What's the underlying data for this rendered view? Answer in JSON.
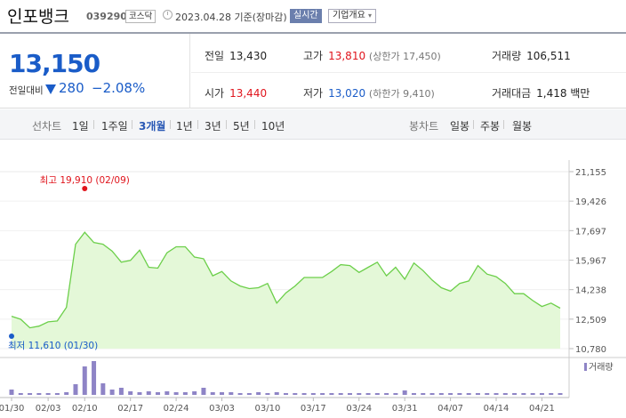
{
  "header": {
    "name": "인포뱅크",
    "code": "039290",
    "market": "코스닥",
    "date": "2023.04.28",
    "basis": "기준(장마감)",
    "live_label": "실시간",
    "corp_label": "기업개요"
  },
  "summary": {
    "price": "13,150",
    "change_label": "전일대비",
    "change_value": "280",
    "change_rate": "−2.08%",
    "prev_close": {
      "label": "전일",
      "value": "13,430"
    },
    "high": {
      "label": "고가",
      "value": "13,810",
      "sub": "(상한가 17,450)"
    },
    "volume": {
      "label": "거래량",
      "value": "106,511"
    },
    "open": {
      "label": "시가",
      "value": "13,440"
    },
    "low": {
      "label": "저가",
      "value": "13,020",
      "sub": "(하한가 9,410)"
    },
    "amount": {
      "label": "거래대금",
      "value": "1,418 백만"
    }
  },
  "period_bar": {
    "line_label": "선차트",
    "periods": [
      "1일",
      "1주일",
      "3개월",
      "1년",
      "3년",
      "5년",
      "10년"
    ],
    "active_period": "3개월",
    "candle_label": "봉차트",
    "candles": [
      "일봉",
      "주봉",
      "월봉"
    ]
  },
  "colors": {
    "up": "#e0151d",
    "down": "#1a5cc8",
    "line": "#6ccf4a",
    "fill": "#e4f8d8",
    "volume": "#8e84c6"
  },
  "chart_data": {
    "type": "area",
    "title": "",
    "y_ticks": [
      "21,155",
      "19,426",
      "17,697",
      "15,967",
      "14,238",
      "12,509",
      "10,780"
    ],
    "ylim": [
      10780,
      21155
    ],
    "x_tick_labels": [
      "01/30",
      "02/03",
      "02/10",
      "02/17",
      "02/24",
      "03/03",
      "03/10",
      "03/17",
      "03/24",
      "03/31",
      "04/07",
      "04/14",
      "04/21"
    ],
    "x_tick_index": [
      0,
      4,
      8,
      13,
      18,
      23,
      28,
      33,
      38,
      43,
      48,
      53,
      58
    ],
    "series": [
      {
        "values": [
          12680,
          12500,
          12000,
          12100,
          12350,
          12400,
          13200,
          16900,
          17600,
          17000,
          16900,
          16500,
          15850,
          15950,
          16550,
          15550,
          15500,
          16400,
          16750,
          16750,
          16150,
          16050,
          15050,
          15300,
          14750,
          14450,
          14300,
          14350,
          14600,
          13450,
          14050,
          14450,
          14950,
          14950,
          14950,
          15300,
          15700,
          15650,
          15250,
          15550,
          15850,
          15050,
          15550,
          14850,
          15800,
          15350,
          14800,
          14350,
          14150,
          14600,
          14750,
          15650,
          15150,
          15000,
          14600,
          14000,
          14000,
          13600,
          13250,
          13450,
          13150
        ]
      }
    ],
    "max_annotation": {
      "text": "최고 19,910 (02/09)",
      "index": 8
    },
    "min_annotation": {
      "text": "최저 11,610 (01/30)",
      "index": 0
    },
    "volume_label": "거래량",
    "volume": [
      6,
      2,
      2,
      2,
      2,
      2,
      3,
      12,
      32,
      38,
      13,
      6,
      8,
      4,
      3,
      4,
      3,
      4,
      3,
      3,
      4,
      8,
      3,
      3,
      3,
      2,
      2,
      3,
      2,
      3,
      2,
      2,
      2,
      2,
      2,
      2,
      2,
      2,
      2,
      2,
      2,
      2,
      2,
      5,
      2,
      2,
      2,
      2,
      2,
      2,
      2,
      2,
      2,
      2,
      2,
      2,
      2,
      2,
      2,
      2,
      2
    ]
  }
}
